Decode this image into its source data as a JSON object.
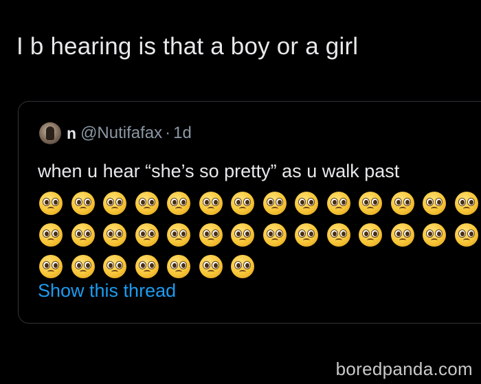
{
  "tweet": {
    "text": "I b hearing is that a boy or a girl"
  },
  "quoted_tweet": {
    "display_name": "n",
    "handle": "@Nutifafax",
    "separator": "·",
    "time": "1d",
    "text": "when u hear “she’s so pretty” as u walk past",
    "emoji": {
      "name": "pleading-face-emoji",
      "rows": [
        14,
        14,
        7
      ]
    },
    "show_thread_label": "Show this thread"
  },
  "watermark": "boredpanda.com",
  "colors": {
    "background": "#000000",
    "text": "#e7e9ea",
    "secondary_text": "#8b98a5",
    "link": "#1d9bf0",
    "border": "#2f3336"
  }
}
